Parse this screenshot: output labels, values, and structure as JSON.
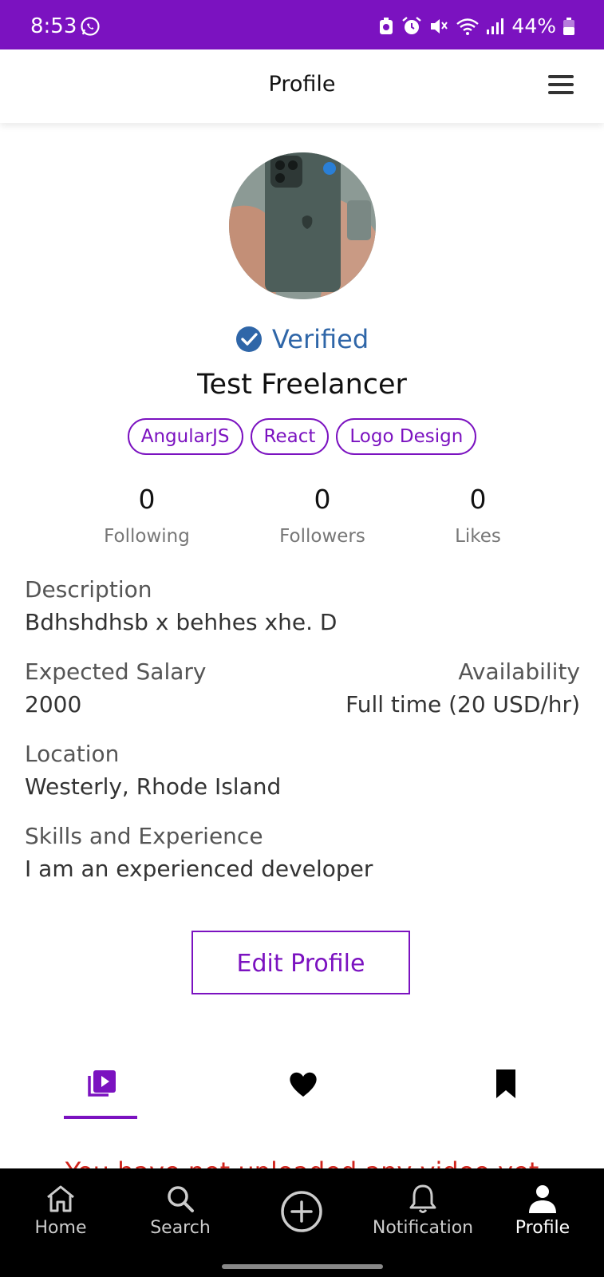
{
  "status_bar": {
    "time": "8:53",
    "battery": "44%"
  },
  "header": {
    "title": "Profile"
  },
  "profile": {
    "verified_label": "Verified",
    "name": "Test Freelancer",
    "tags": [
      "AngularJS",
      "React",
      "Logo Design"
    ],
    "stats": [
      {
        "value": "0",
        "label": "Following"
      },
      {
        "value": "0",
        "label": "Followers"
      },
      {
        "value": "0",
        "label": "Likes"
      }
    ],
    "description": {
      "label": "Description",
      "value": "Bdhshdhsb x behhes xhe. D"
    },
    "expected_salary": {
      "label": "Expected Salary",
      "value": "2000"
    },
    "availability": {
      "label": "Availability",
      "value": "Full time (20 USD/hr)"
    },
    "location": {
      "label": "Location",
      "value": "Westerly, Rhode Island"
    },
    "skills": {
      "label": "Skills and Experience",
      "value": "I am an experienced developer"
    },
    "edit_button": "Edit Profile"
  },
  "content_tabs": [
    "video-library-icon",
    "heart-icon",
    "bookmark-icon"
  ],
  "empty_message": "You have not uploaded any video yet",
  "bottom_nav": [
    {
      "label": "Home",
      "icon": "home-icon"
    },
    {
      "label": "Search",
      "icon": "search-icon"
    },
    {
      "label": "",
      "icon": "add-circle-icon"
    },
    {
      "label": "Notification",
      "icon": "bell-icon"
    },
    {
      "label": "Profile",
      "icon": "person-icon"
    }
  ],
  "colors": {
    "brand": "#7b12c0",
    "verified": "#2f66a8",
    "error": "#d0241c"
  }
}
